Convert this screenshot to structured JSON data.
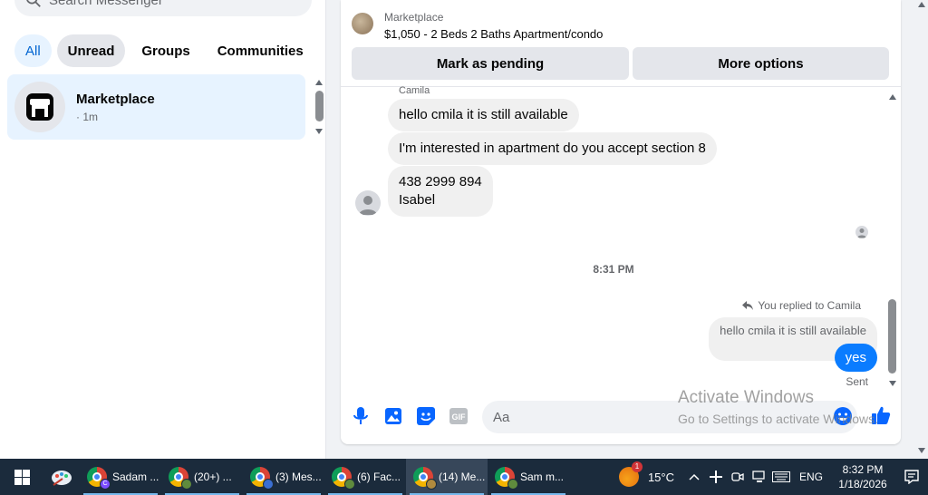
{
  "sidebar": {
    "search_placeholder": "Search Messenger",
    "filters": [
      "All",
      "Unread",
      "Groups",
      "Communities"
    ],
    "conversation": {
      "name": "Marketplace",
      "time": "· 1m"
    }
  },
  "chat": {
    "listing": {
      "label": "Marketplace",
      "title": "$1,050 - 2 Beds 2 Baths Apartment/condo",
      "mark_pending": "Mark as pending",
      "more_options": "More options"
    },
    "sender_name": "Camila",
    "messages_in": [
      "hello cmila it is still available",
      "I'm interested in apartment do you accept section 8",
      "438 2999 894",
      "Isabel"
    ],
    "timestamp": "8:31 PM",
    "reply_note": "You replied to Camila",
    "quoted": "hello cmila it is still available",
    "my_message": "yes",
    "status": "Sent",
    "composer_placeholder": "Aa"
  },
  "watermark": {
    "line1": "Activate Windows",
    "line2": "Go to Settings to activate Windows."
  },
  "taskbar": {
    "apps": [
      {
        "label": "Sadam ..."
      },
      {
        "label": "(20+) ..."
      },
      {
        "label": "(3) Mes..."
      },
      {
        "label": "(6) Fac..."
      },
      {
        "label": "(14) Me..."
      },
      {
        "label": "Sam m..."
      }
    ],
    "weather_badge": "1",
    "temperature": "15°C",
    "language": "ENG",
    "time": "8:32 PM",
    "date": "1/18/2026"
  },
  "colors": {
    "accent": "#0a7cff",
    "selected_bg": "#e7f3ff",
    "icon_blue": "#0866ff",
    "taskbar": "#1b2b3c"
  }
}
